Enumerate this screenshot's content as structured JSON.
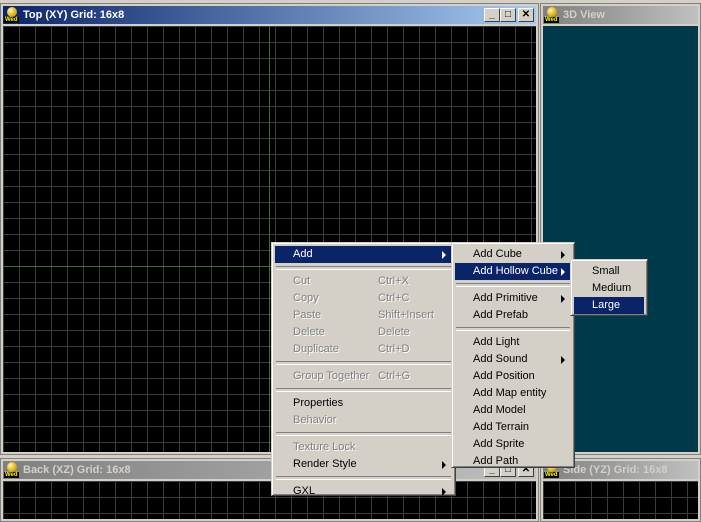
{
  "windows": {
    "top": {
      "title": "Top (XY) Grid: 16x8"
    },
    "view3d": {
      "title": "3D View"
    },
    "back": {
      "title": "Back (XZ) Grid: 16x8"
    },
    "side": {
      "title": "Side (YZ) Grid: 16x8"
    },
    "icon_text": "Wed",
    "minimize_glyph": "_",
    "maximize_glyph": "□",
    "close_glyph": "✕"
  },
  "context_menu": {
    "add": "Add",
    "cut": "Cut",
    "cut_sc": "Ctrl+X",
    "copy": "Copy",
    "copy_sc": "Ctrl+C",
    "paste": "Paste",
    "paste_sc": "Shift+Insert",
    "delete": "Delete",
    "delete_sc": "Delete",
    "duplicate": "Duplicate",
    "duplicate_sc": "Ctrl+D",
    "group_together": "Group Together",
    "group_together_sc": "Ctrl+G",
    "properties": "Properties",
    "behavior": "Behavior",
    "texture_lock": "Texture Lock",
    "render_style": "Render Style",
    "gxl": "GXL"
  },
  "add_submenu": {
    "add_cube": "Add Cube",
    "add_hollow_cube": "Add Hollow Cube",
    "add_primitive": "Add Primitive",
    "add_prefab": "Add Prefab",
    "add_light": "Add Light",
    "add_sound": "Add Sound",
    "add_position": "Add Position",
    "add_map_entity": "Add Map entity",
    "add_model": "Add Model",
    "add_terrain": "Add Terrain",
    "add_sprite": "Add Sprite",
    "add_path": "Add Path"
  },
  "hollow_cube_submenu": {
    "small": "Small",
    "medium": "Medium",
    "large": "Large"
  },
  "colors": {
    "title_active": "#0a246a",
    "title_inactive": "#808080",
    "grid_bg": "#000000",
    "grid_line": "#3b3b3b",
    "view3d_bg": "#003a4a",
    "menu_bg": "#d4d0c8",
    "highlight": "#0a246a"
  }
}
